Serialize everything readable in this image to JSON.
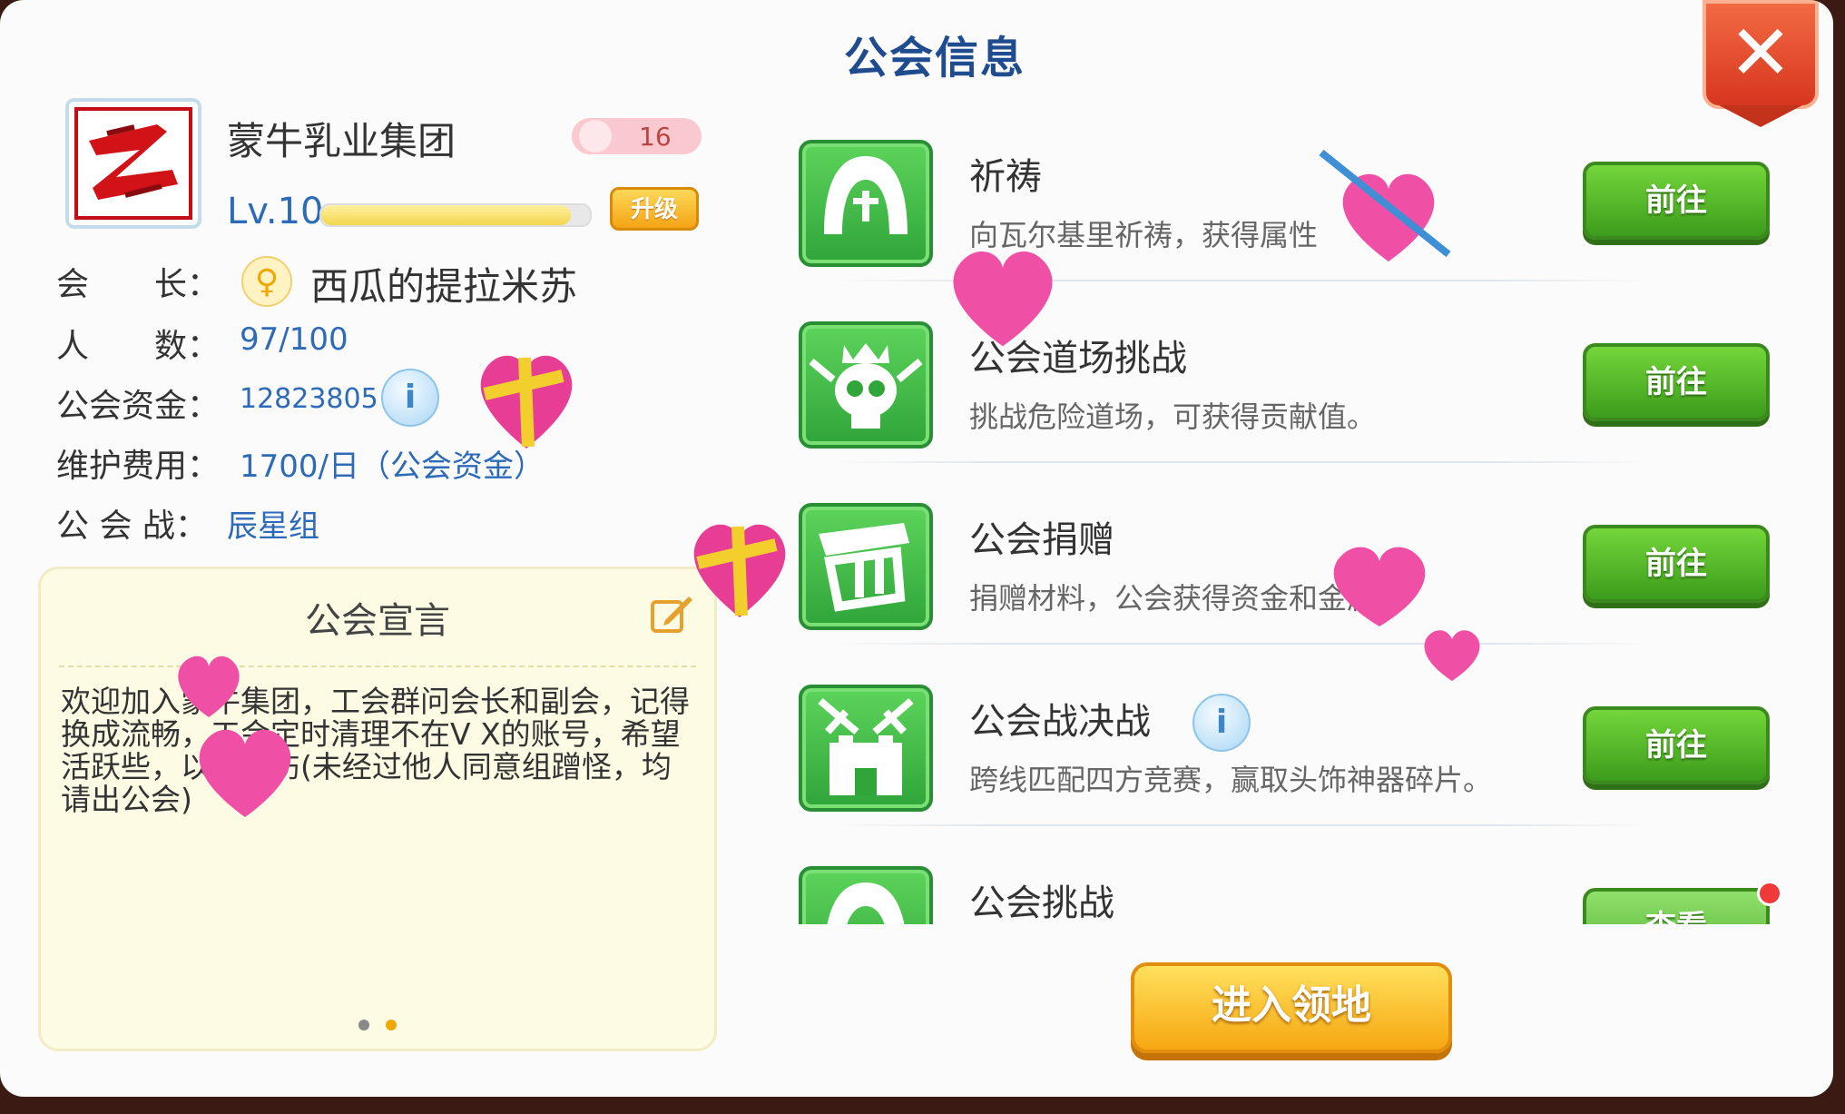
{
  "dialog": {
    "title": "公会信息",
    "close_label": "✕"
  },
  "guild": {
    "name": "蒙牛乳业集团",
    "points": "16",
    "level": "Lv.10",
    "level_progress": 0.93,
    "upgrade_label": "升级",
    "leader_label": "会　　长：",
    "leader_name": "西瓜的提拉米苏",
    "members_label": "人　　数：",
    "members_value": "97/100",
    "funds_label": "公会资金：",
    "funds_value": "12823805",
    "upkeep_label": "维护费用：",
    "upkeep_value": "1700/日（公会资金）",
    "war_label": "公 会 战：",
    "war_value": "辰星组"
  },
  "declaration": {
    "title": "公会宣言",
    "text": "欢迎加入蒙牛集团，工会群问会长和副会，记得换成流畅，工会定时清理不在V X的账号，希望活跃些，以免误伤(未经过他人同意组蹭怪，均请出公会)"
  },
  "activities": [
    {
      "name": "祈祷",
      "desc": "向瓦尔基里祈祷，获得属性",
      "button": "前往",
      "icon": "prayer-icon"
    },
    {
      "name": "公会道场挑战",
      "desc": "挑战危险道场，可获得贡献值。",
      "button": "前往",
      "icon": "skull-icon"
    },
    {
      "name": "公会捐赠",
      "desc": "捐赠材料，公会获得资金和金属",
      "button": "前往",
      "icon": "donate-box-icon"
    },
    {
      "name": "公会战决战",
      "desc": "跨线匹配四方竞赛，赢取头饰神器碎片。",
      "button": "前往",
      "icon": "castle-swords-icon"
    },
    {
      "name": "公会挑战",
      "desc": "",
      "button": "查看",
      "icon": "prayer-icon"
    }
  ],
  "enter_button": "进入领地",
  "colors": {
    "accent_blue": "#2d6ab8",
    "green_button": "#4cb126",
    "orange_button": "#f6a711",
    "close_red": "#d8361f"
  }
}
